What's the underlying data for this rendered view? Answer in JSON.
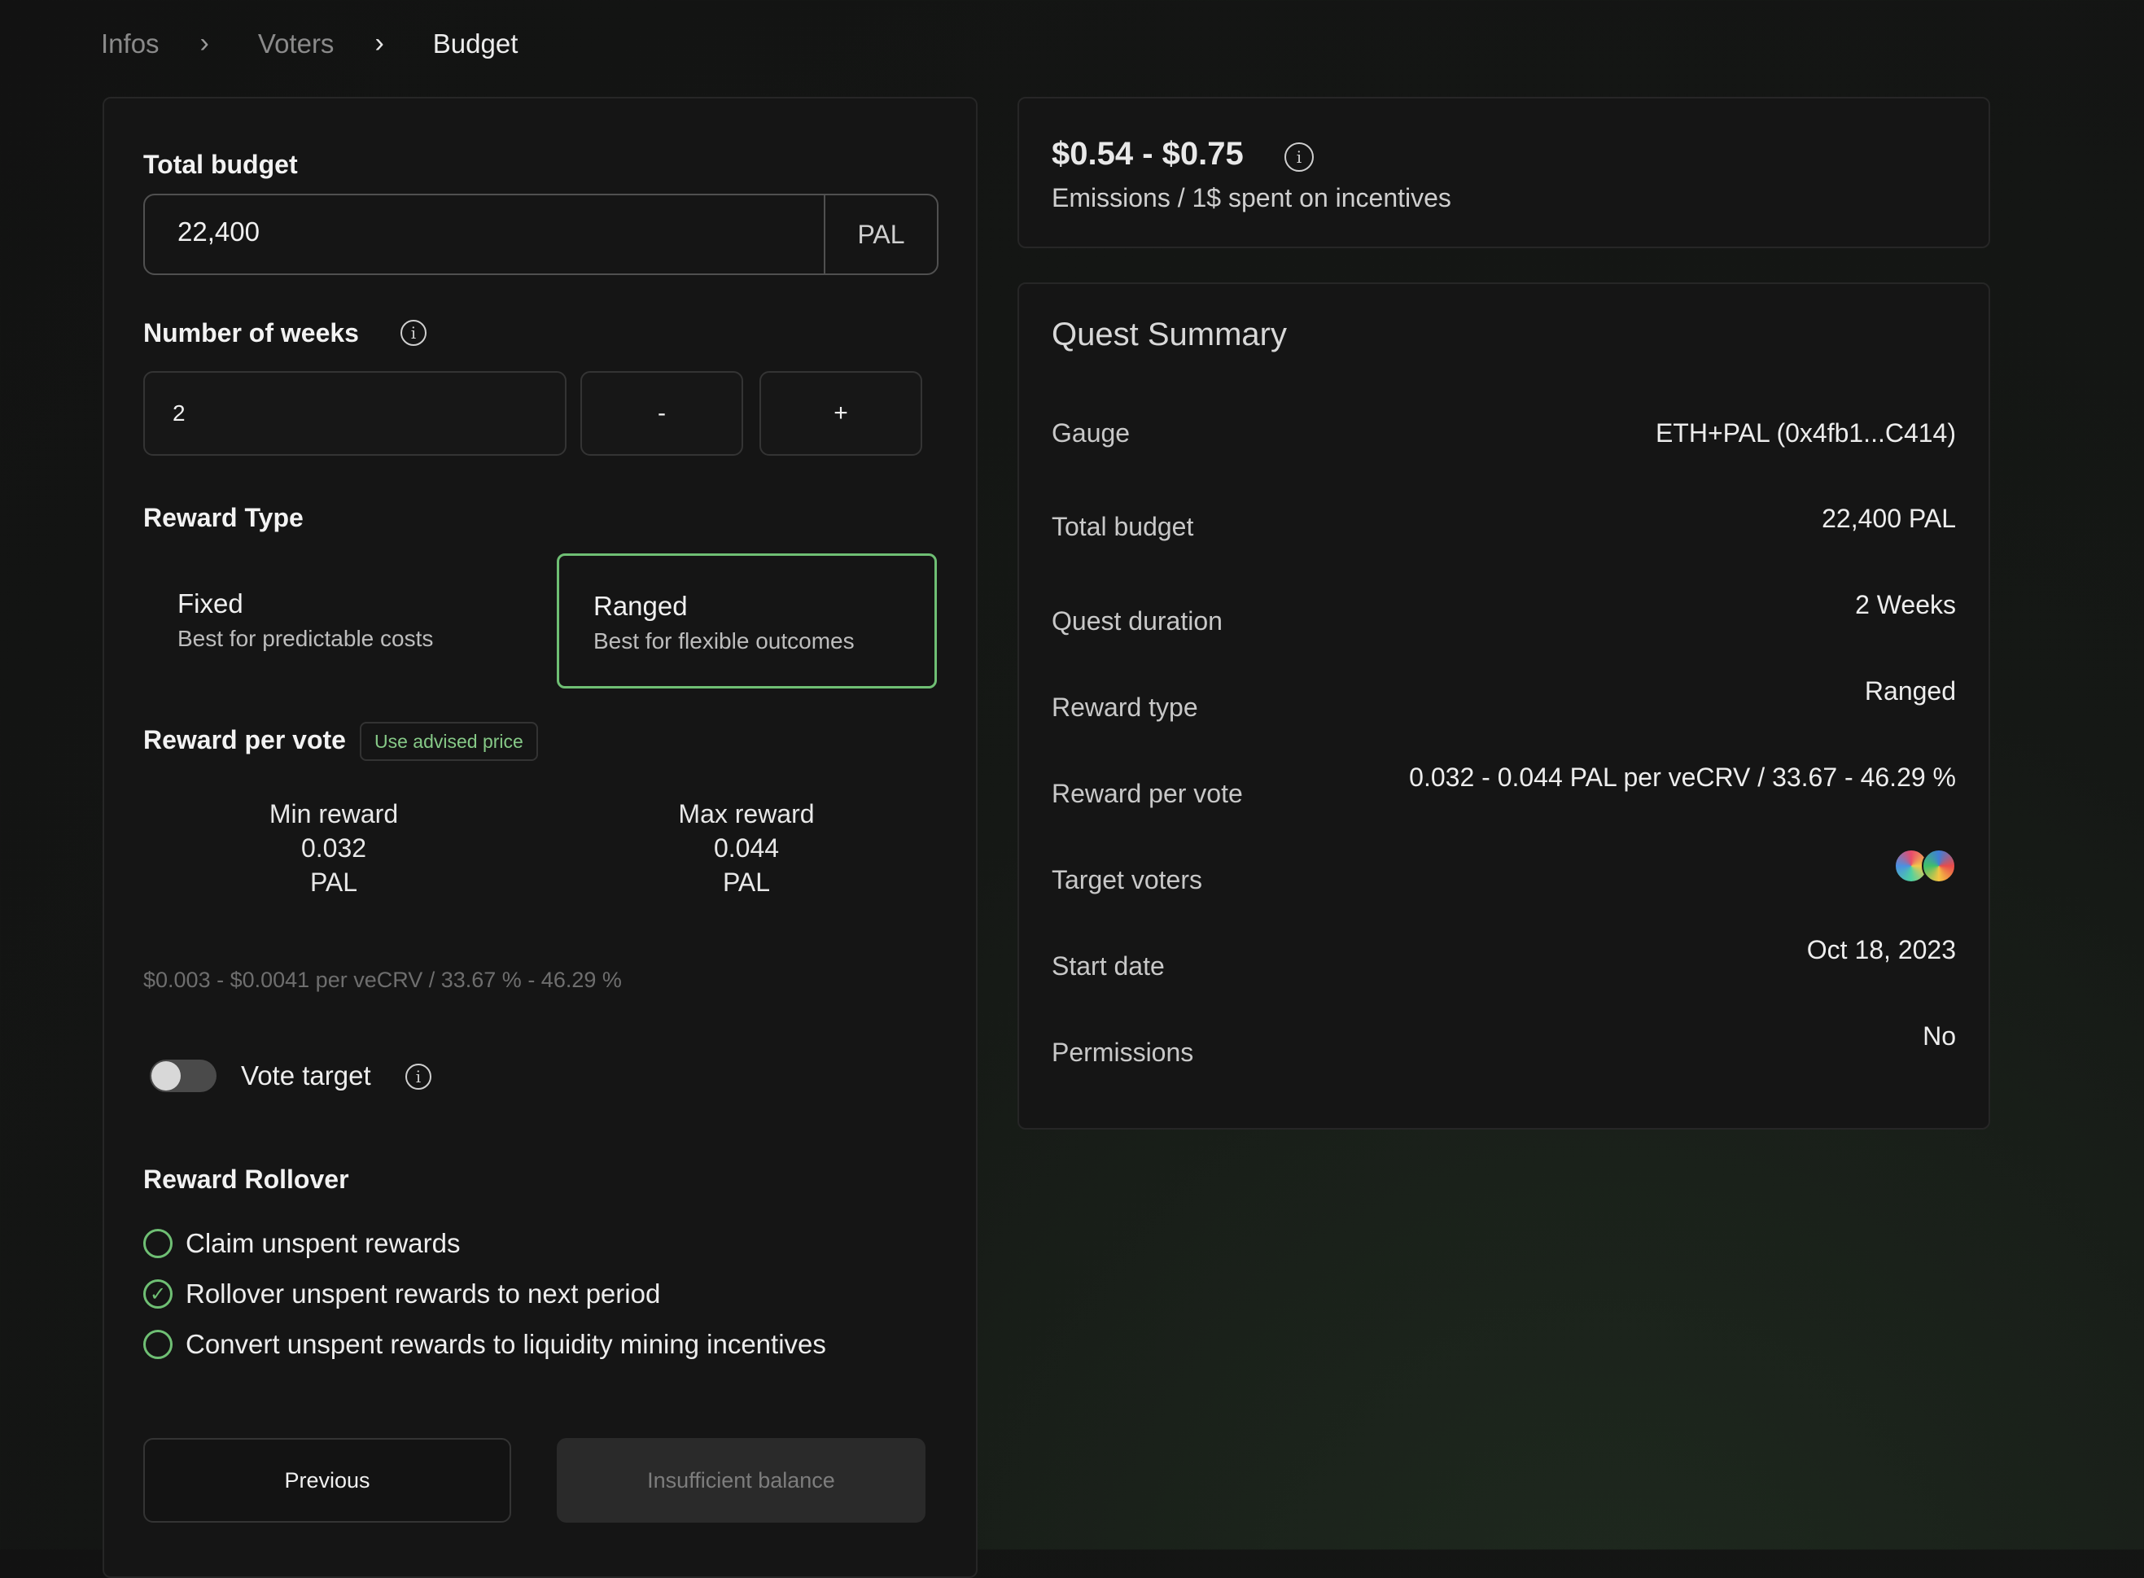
{
  "breadcrumb": {
    "items": [
      "Infos",
      "Voters",
      "Budget"
    ],
    "separator": ">"
  },
  "form": {
    "total_budget": {
      "label": "Total budget",
      "value": "22,400",
      "unit": "PAL"
    },
    "weeks": {
      "label": "Number of weeks",
      "value": "2",
      "minus": "-",
      "plus": "+"
    },
    "reward_type": {
      "label": "Reward Type",
      "options": [
        {
          "title": "Fixed",
          "subtitle": "Best for predictable costs"
        },
        {
          "title": "Ranged",
          "subtitle": "Best for flexible outcomes"
        }
      ],
      "selected": "Ranged"
    },
    "reward_per_vote": {
      "label": "Reward per vote",
      "advised_button": "Use advised price",
      "min": {
        "label": "Min reward",
        "value": "0.032",
        "unit": "PAL"
      },
      "max": {
        "label": "Max reward",
        "value": "0.044",
        "unit": "PAL"
      },
      "usd_note": "$0.003 - $0.0041 per veCRV / 33.67 % - 46.29 %"
    },
    "vote_target": {
      "label": "Vote target",
      "enabled": false
    },
    "rollover": {
      "label": "Reward Rollover",
      "options": [
        {
          "label": "Claim unspent rewards",
          "checked": false
        },
        {
          "label": "Rollover unspent rewards to next period",
          "checked": true
        },
        {
          "label": "Convert unspent rewards to liquidity mining incentives",
          "checked": false
        }
      ]
    },
    "buttons": {
      "previous": "Previous",
      "submit": "Insufficient balance"
    }
  },
  "emissions": {
    "range": "$0.54 - $0.75",
    "subtitle": "Emissions / 1$ spent on incentives"
  },
  "summary": {
    "title": "Quest Summary",
    "rows": [
      {
        "label": "Gauge",
        "value": "ETH+PAL (0x4fb1...C414)"
      },
      {
        "label": "Total budget",
        "value": "22,400 PAL"
      },
      {
        "label": "Quest duration",
        "value": "2 Weeks"
      },
      {
        "label": "Reward type",
        "value": "Ranged"
      },
      {
        "label": "Reward per vote",
        "value": "0.032 - 0.044 PAL per veCRV / 33.67 - 46.29 %"
      },
      {
        "label": "Target voters",
        "value": ""
      },
      {
        "label": "Start date",
        "value": "Oct 18, 2023"
      },
      {
        "label": "Permissions",
        "value": "No"
      }
    ]
  },
  "colors": {
    "accent": "#6fbf74",
    "background": "#121212",
    "card": "#151515"
  },
  "icons": [
    "chevron-right-icon",
    "info-icon",
    "check-circle-icon",
    "voter-avatar-icon"
  ]
}
